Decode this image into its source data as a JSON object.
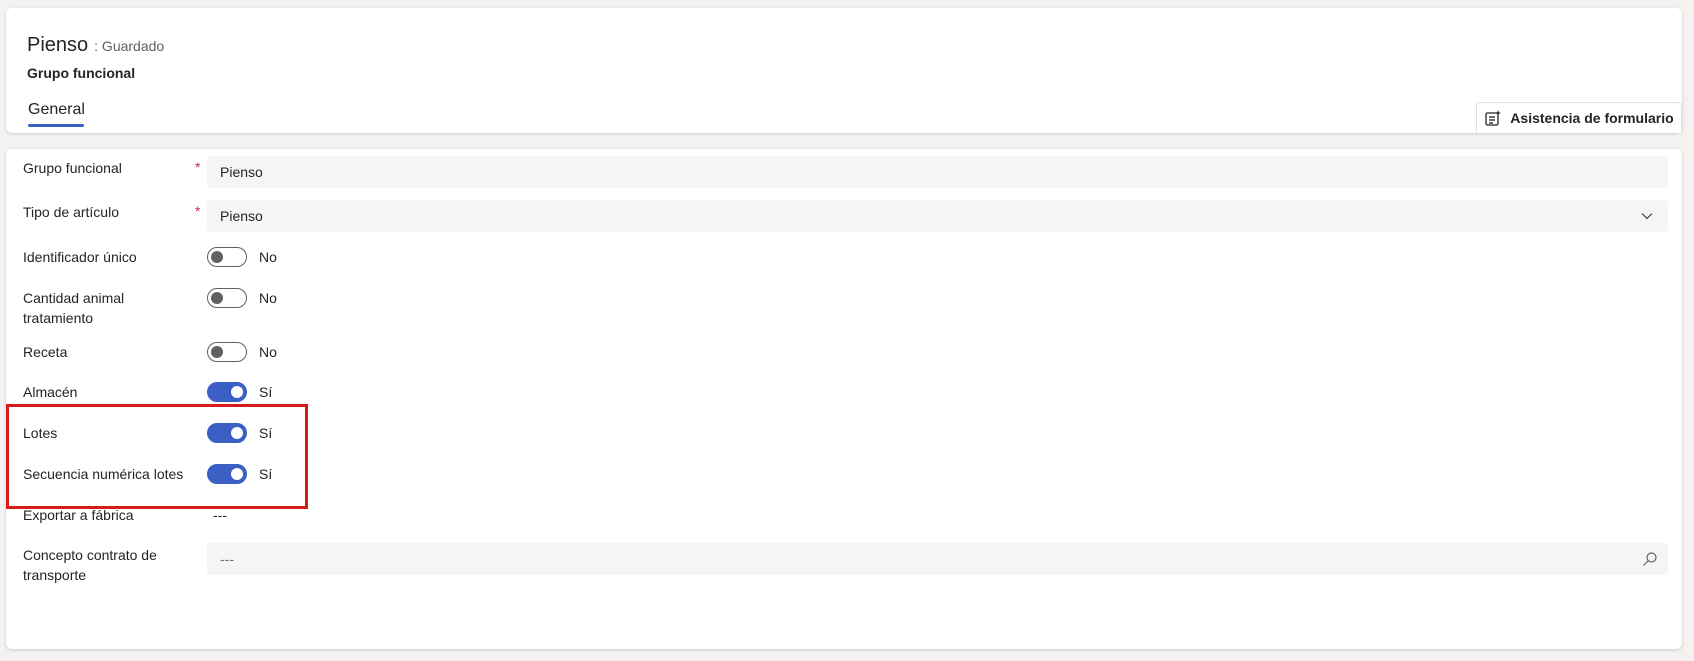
{
  "header": {
    "title": "Pienso",
    "saved_status": ": Guardado",
    "entity_type": "Grupo funcional",
    "tabs": [
      {
        "label": "General",
        "selected": true
      }
    ],
    "assist_button": "Asistencia de formulario"
  },
  "form": {
    "grupo_funcional": {
      "label": "Grupo funcional",
      "required": true,
      "value": "Pienso"
    },
    "tipo_articulo": {
      "label": "Tipo de artículo",
      "required": true,
      "value": "Pienso"
    },
    "identificador_unico": {
      "label": "Identificador único",
      "value": false,
      "text": "No"
    },
    "cantidad_animal": {
      "label_line1": "Cantidad animal",
      "label_line2": "tratamiento",
      "value": false,
      "text": "No"
    },
    "receta": {
      "label": "Receta",
      "value": false,
      "text": "No"
    },
    "almacen": {
      "label": "Almacén",
      "value": true,
      "text": "Sí"
    },
    "lotes": {
      "label": "Lotes",
      "value": true,
      "text": "Sí"
    },
    "secuencia": {
      "label": "Secuencia numérica lotes",
      "value": true,
      "text": "Sí"
    },
    "exportar": {
      "label": "Exportar a fábrica",
      "value": "---"
    },
    "concepto": {
      "label_line1": "Concepto contrato de",
      "label_line2": "transporte",
      "placeholder": "---"
    }
  },
  "colors": {
    "accent": "#3b5fc4",
    "highlight": "#d71a1a",
    "required": "#c4314b"
  },
  "icons": [
    "form-assist-icon",
    "chevron-down-icon",
    "search-icon"
  ]
}
